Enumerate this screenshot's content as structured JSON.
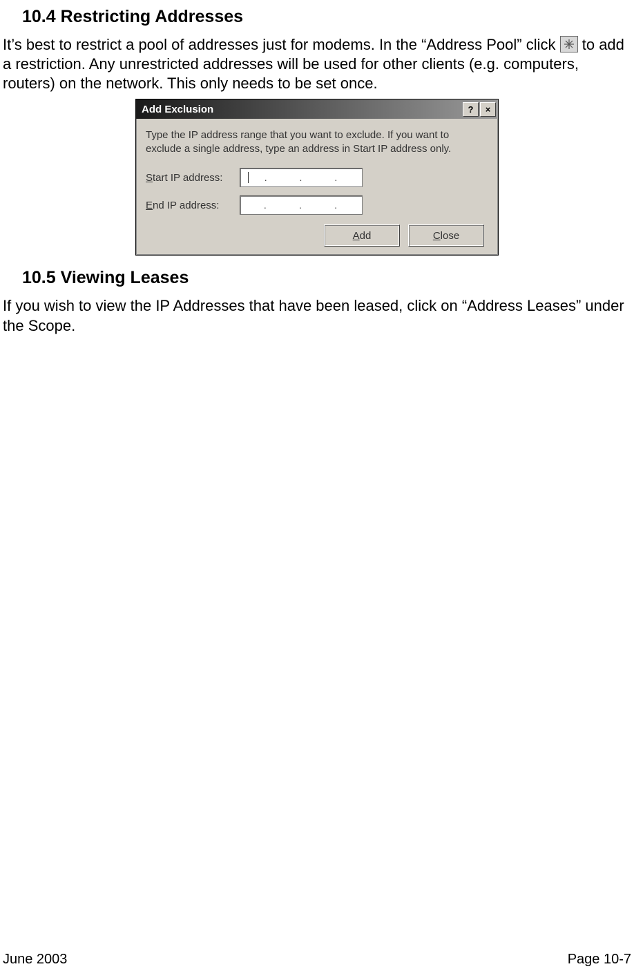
{
  "section1": {
    "heading": "10.4  Restricting Addresses",
    "para_before_icon": "It’s best to restrict a pool of addresses just for modems. In the “Address Pool” click ",
    "para_after_icon": " to add a restriction.  Any unrestricted addresses will be used for other clients (e.g. computers, routers) on the network. This only needs to be set once."
  },
  "dialog": {
    "title": "Add Exclusion",
    "help_glyph": "?",
    "close_glyph": "×",
    "description": "Type the IP address range that you want to exclude. If you want to exclude a single address, type an address in Start IP address only.",
    "start_label_ul": "S",
    "start_label_rest": "tart IP address:",
    "end_label_ul": "E",
    "end_label_rest": "nd IP address:",
    "add_ul": "A",
    "add_rest": "dd",
    "close_ul": "C",
    "close_rest": "lose"
  },
  "section2": {
    "heading": "10.5  Viewing Leases",
    "para": "If you wish to view the IP Addresses that have been leased, click on “Address Leases” under the Scope."
  },
  "footer": {
    "date": "June 2003",
    "page": "Page 10-7"
  }
}
